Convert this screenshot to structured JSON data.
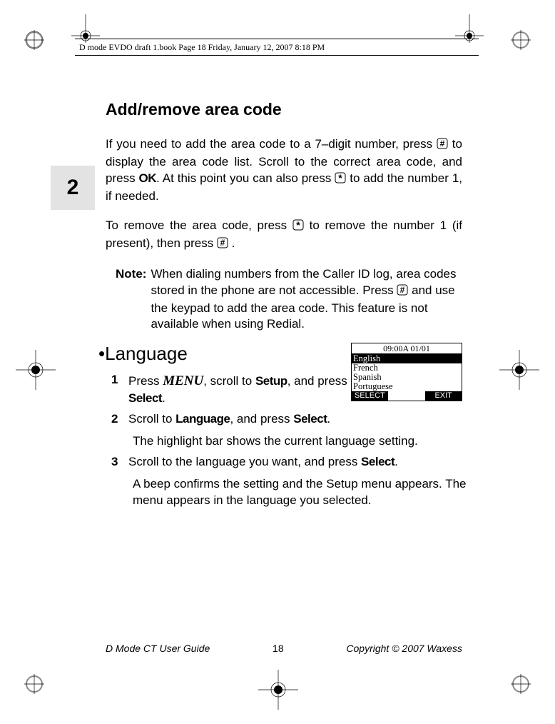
{
  "header": {
    "running": "D mode EVDO draft 1.book  Page 18  Friday, January 12, 2007  8:18 PM"
  },
  "chapter": {
    "number": "2"
  },
  "section1": {
    "title": "Add/remove area code",
    "p1_a": "If you need to add the area code to a 7–digit number, press ",
    "p1_b": " to display the area code list. Scroll to the correct area code, and press ",
    "p1_c": ". At this point you can also press ",
    "p1_d": " to add the number 1, if needed.",
    "p2_a": "To remove the area code, press ",
    "p2_b": " to remove the number 1 (if present), then press ",
    "p2_c": " .",
    "note_label": "Note:",
    "note_a": "When dialing numbers from the Caller ID log, area codes stored in the phone are not accessible. Press ",
    "note_b": " and use the keypad to add the area code. This feature is not available when using Redial."
  },
  "section2": {
    "heading": "•Language",
    "step1_a": "Press ",
    "step1_menu": "MENU",
    "step1_b": ", scroll to ",
    "step1_setup": "Setup",
    "step1_c": ", and press ",
    "step1_select": "Select",
    "step1_d": ".",
    "step2_a": "Scroll to ",
    "step2_language": "Language",
    "step2_b": ", and press ",
    "step2_select": "Select",
    "step2_c": ".",
    "step2_sub": "The highlight bar shows the current language setting.",
    "step3_a": "Scroll to the language you want, and press ",
    "step3_select": "Select",
    "step3_b": ".",
    "step3_sub": "A beep confirms the setting and the Setup menu appears. The menu appears in the language you selected."
  },
  "phone": {
    "status": "09:00A 01/01",
    "opts": [
      "English",
      "French",
      "Spanish",
      "Portuguese"
    ],
    "soft_left": "SELECT",
    "soft_right": "EXIT"
  },
  "footer": {
    "left": "D Mode CT User Guide",
    "page": "18",
    "right": "Copyright © 2007 Waxess"
  },
  "icons": {
    "hash": "hash-icon",
    "ok": "ok-icon",
    "star": "star-icon"
  }
}
